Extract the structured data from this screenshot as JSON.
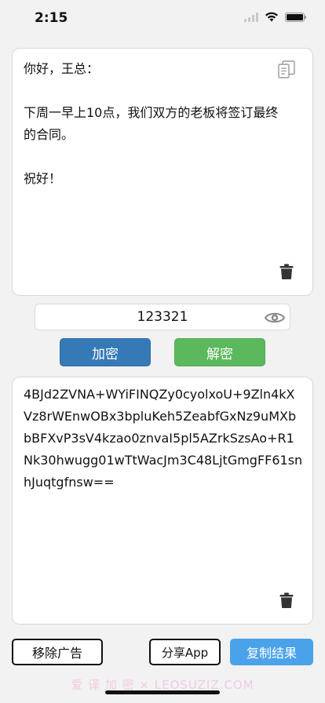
{
  "status_bar": {
    "time": "2:15"
  },
  "input": {
    "text": "你好，王总：\n\n下周一早上10点，我们双方的老板将签订最终的合同。\n\n祝好！"
  },
  "password": {
    "value": "123321"
  },
  "actions": {
    "encrypt_label": "加密",
    "decrypt_label": "解密"
  },
  "output": {
    "text": "4BJd2ZVNA+WYiFINQZy0cyolxoU+9Zln4kXVz8rWEnwOBx3bpluKeh5ZeabfGxNz9uMXbbBFXvP3sV4kzao0znvaI5pl5AZrkSzsAo+R1Nk30hwugg01wTtWacJm3C48LjtGmgFF61snhJuqtgfnsw=="
  },
  "footer": {
    "remove_ads_label": "移除广告",
    "share_app_label": "分享App",
    "copy_result_label": "复制结果",
    "watermark": "爱 译 加 密 × LEOSUZIZ.COM"
  },
  "colors": {
    "encrypt": "#357ab7",
    "decrypt": "#5cb85c",
    "copy_result": "#4aa3ea"
  },
  "icons": {
    "copy": "copy-icon",
    "delete": "trash-icon",
    "visibility": "eye-icon"
  }
}
